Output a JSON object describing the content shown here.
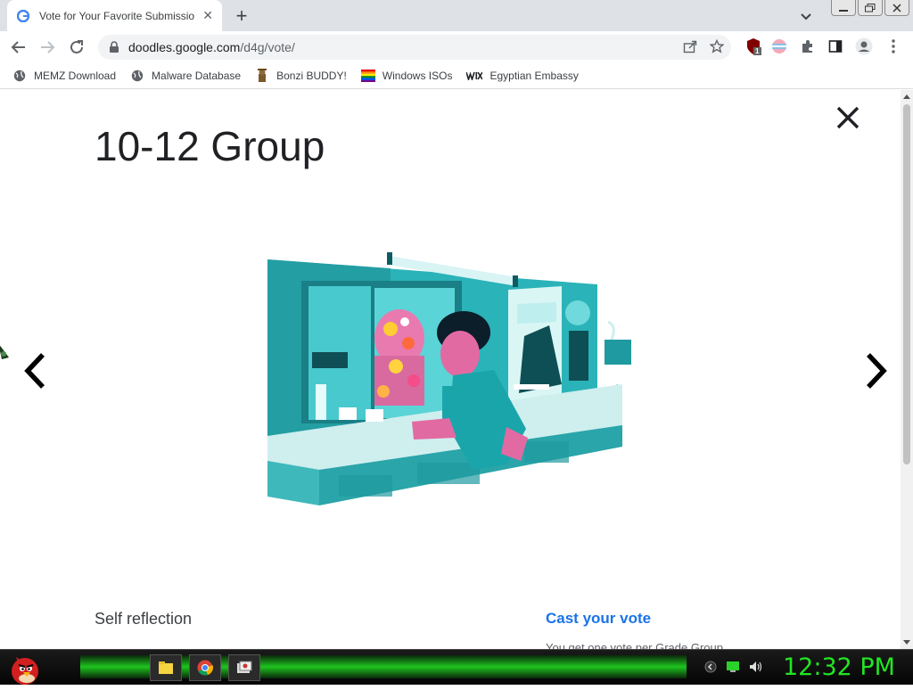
{
  "browser": {
    "tab_title": "Vote for Your Favorite Submissio",
    "new_tab_symbol": "+",
    "url_host": "doodles.google.com",
    "url_path": "/d4g/vote/",
    "extension_badge": "1"
  },
  "bookmarks": [
    {
      "label": "MEMZ Download",
      "icon": "globe-icon"
    },
    {
      "label": "Malware Database",
      "icon": "globe-icon"
    },
    {
      "label": "Bonzi BUDDY!",
      "icon": "bonzi-icon"
    },
    {
      "label": "Windows ISOs",
      "icon": "windows-flag-icon"
    },
    {
      "label": "Egyptian Embassy",
      "icon": "wix-icon"
    }
  ],
  "page": {
    "heading": "10-12 Group",
    "caption": "Self reflection",
    "vote_title": "Cast your vote",
    "vote_subtitle": "You get one vote per Grade Group"
  },
  "taskbar": {
    "clock": "12:32 PM"
  }
}
